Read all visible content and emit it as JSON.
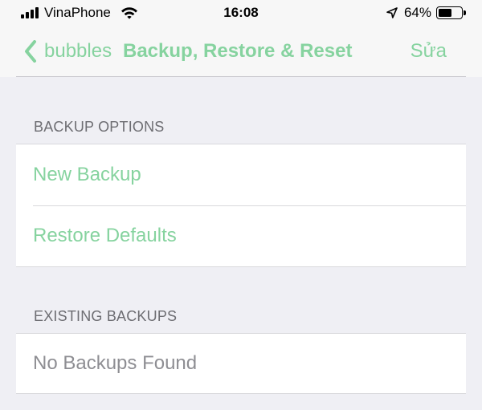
{
  "status_bar": {
    "carrier": "VinaPhone",
    "time": "16:08",
    "battery_percent": "64%",
    "battery_level": 0.64,
    "icons": [
      "signal-bars",
      "wifi",
      "location-arrow",
      "battery"
    ]
  },
  "nav_bar": {
    "back_label": "bubbles",
    "title": "Backup, Restore & Reset",
    "edit_label": "Sửa"
  },
  "sections": {
    "backup_options": {
      "header": "BACKUP OPTIONS",
      "items": [
        {
          "label": "New Backup"
        },
        {
          "label": "Restore Defaults"
        }
      ]
    },
    "existing_backups": {
      "header": "EXISTING BACKUPS",
      "empty_text": "No Backups Found"
    }
  },
  "colors": {
    "accent": "#86d39f",
    "background": "#efeff4",
    "secondary_text": "#8e8e93",
    "section_header": "#6d6d72"
  }
}
